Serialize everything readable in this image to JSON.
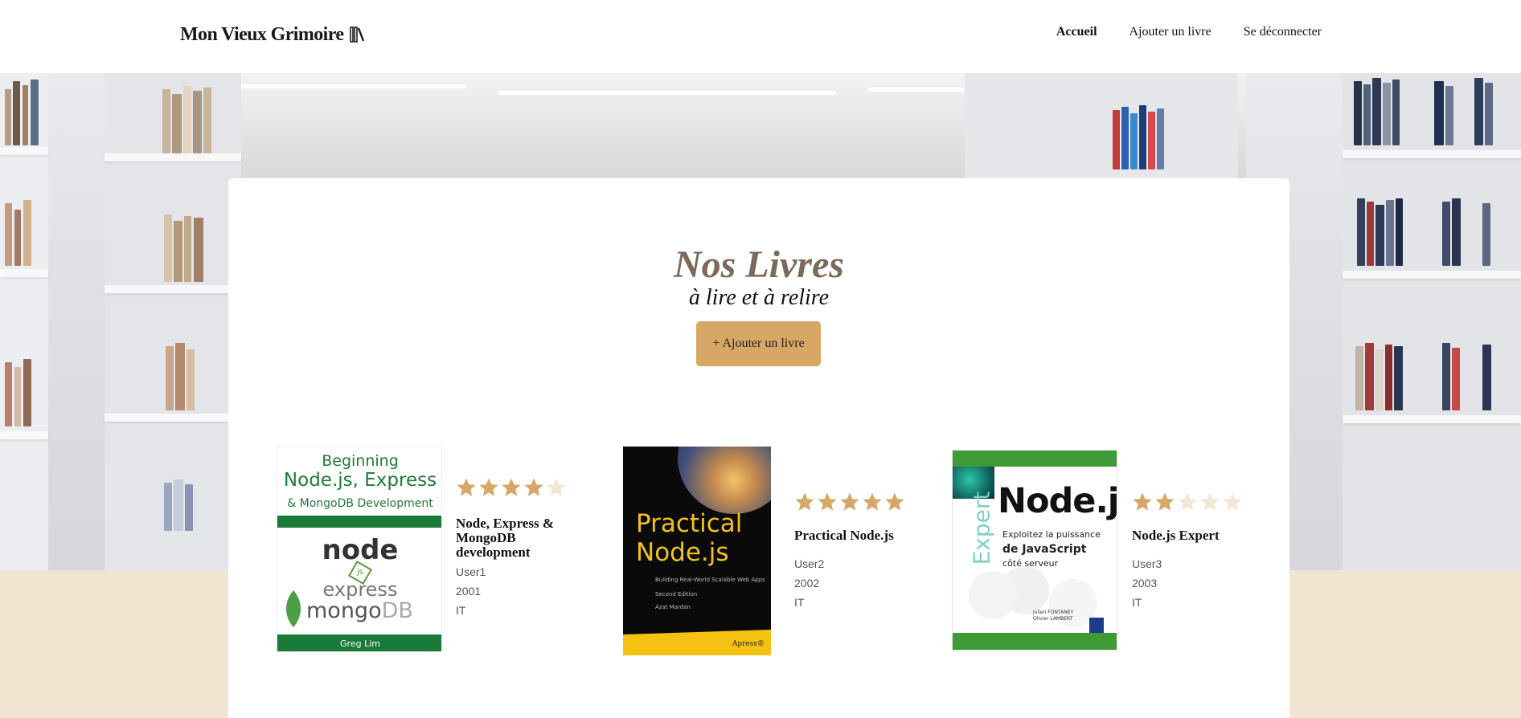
{
  "header": {
    "logo": "Mon Vieux Grimoire",
    "logo_icon": "books-icon",
    "nav": [
      {
        "label": "Accueil",
        "active": true
      },
      {
        "label": "Ajouter un livre",
        "active": false
      },
      {
        "label": "Se déconnecter",
        "active": false
      }
    ]
  },
  "main": {
    "title": "Nos Livres",
    "subtitle": "à lire et à relire",
    "add_button": "+ Ajouter un livre"
  },
  "books": [
    {
      "title": "Node, Express & MongoDB development",
      "user": "User1",
      "year": "2001",
      "genre": "IT",
      "rating": 4,
      "cover": {
        "line1": "Beginning",
        "line2": "Node.js, Express",
        "line3": "& MongoDB Development",
        "logo_node": "node",
        "logo_js": "js",
        "logo_express": "express",
        "logo_mongo": "mongo",
        "logo_db": "DB",
        "author": "Greg Lim"
      }
    },
    {
      "title": "Practical Node.js",
      "user": "User2",
      "year": "2002",
      "genre": "IT",
      "rating": 5,
      "cover": {
        "line1": "Practical",
        "line2": "Node.js",
        "line3": "Building Real-World Scalable Web Apps",
        "edition": "Second Edition",
        "author": "Azat Mardan",
        "publisher": "Apress®"
      }
    },
    {
      "title": "Node.js Expert",
      "user": "User3",
      "year": "2003",
      "genre": "IT",
      "rating": 2,
      "cover": {
        "side": "Expert",
        "big": "Node.js",
        "tag1": "Exploitez la puissance",
        "tag2": "de JavaScript",
        "tag3": "côté serveur",
        "authors1": "Julien FONTANEY",
        "authors2": "Olivier LAMBERT"
      }
    }
  ],
  "colors": {
    "accent": "#d6a765",
    "star_filled": "#d6a765",
    "star_empty": "#f2e6d5",
    "title": "#7b6a5a",
    "page_bottom": "#f3e4d1"
  }
}
